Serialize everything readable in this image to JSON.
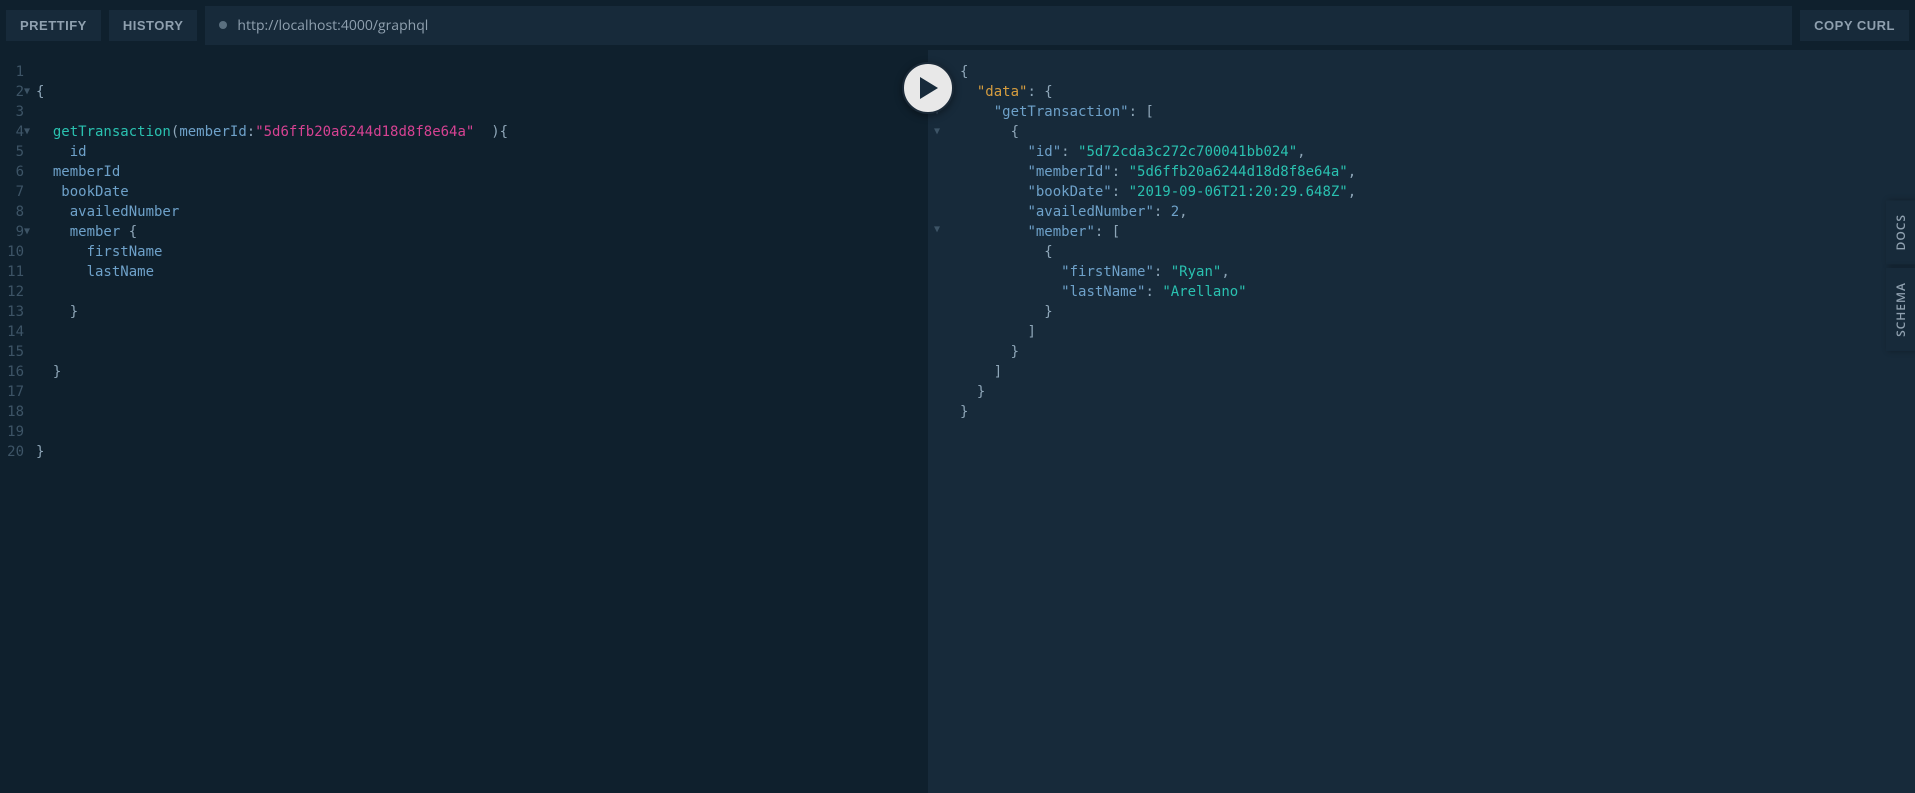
{
  "toolbar": {
    "prettify": "PRETTIFY",
    "history": "HISTORY",
    "url": "http://localhost:4000/graphql",
    "copyCurl": "COPY CURL"
  },
  "sideTabs": {
    "docs": "DOCS",
    "schema": "SCHEMA"
  },
  "editor": {
    "lineCount": 20,
    "lines": {
      "l2": "{",
      "l4_fn": "getTransaction",
      "l4_arg": "memberId",
      "l4_str": "\"5d6ffb20a6244d18d8f8e64a\"",
      "l4_after": "  ){",
      "l5": "id",
      "l6": "memberId",
      "l7": "bookDate",
      "l8": "availedNumber",
      "l9": "member",
      "l9b": " {",
      "l10": "firstName",
      "l11": "lastName",
      "l13": "}",
      "l16": "}",
      "l20": "}"
    }
  },
  "result": {
    "root": "{",
    "dataKey": "\"data\"",
    "getTransKey": "\"getTransaction\"",
    "idKey": "\"id\"",
    "idVal": "\"5d72cda3c272c700041bb024\"",
    "memberIdKey": "\"memberId\"",
    "memberIdVal": "\"5d6ffb20a6244d18d8f8e64a\"",
    "bookDateKey": "\"bookDate\"",
    "bookDateVal": "\"2019-09-06T21:20:29.648Z\"",
    "availedKey": "\"availedNumber\"",
    "availedVal": "2",
    "memberKey": "\"member\"",
    "firstNameKey": "\"firstName\"",
    "firstNameVal": "\"Ryan\"",
    "lastNameKey": "\"lastName\"",
    "lastNameVal": "\"Arellano\""
  }
}
